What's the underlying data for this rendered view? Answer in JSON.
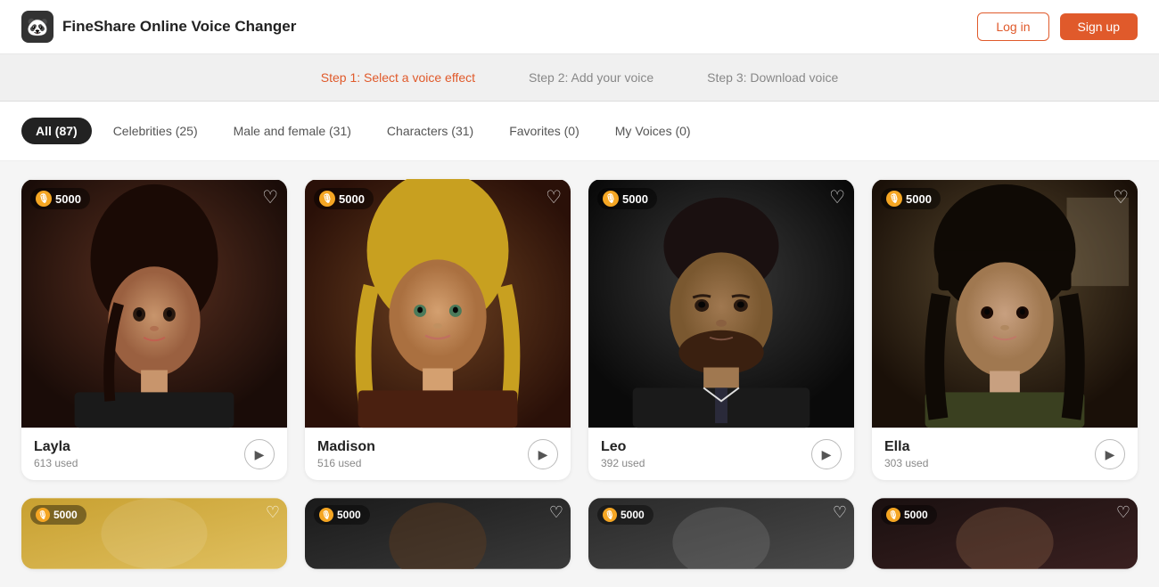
{
  "header": {
    "logo_emoji": "🐼",
    "app_title": "FineShare Online Voice Changer",
    "login_label": "Log in",
    "signup_label": "Sign up"
  },
  "steps": [
    {
      "id": "step1",
      "label": "Step 1: Select a voice effect",
      "active": true
    },
    {
      "id": "step2",
      "label": "Step 2: Add your voice",
      "active": false
    },
    {
      "id": "step3",
      "label": "Step 3: Download voice",
      "active": false
    }
  ],
  "filters": [
    {
      "id": "all",
      "label": "All (87)",
      "active": true
    },
    {
      "id": "celebrities",
      "label": "Celebrities (25)",
      "active": false
    },
    {
      "id": "male-female",
      "label": "Male and female (31)",
      "active": false
    },
    {
      "id": "characters",
      "label": "Characters (31)",
      "active": false
    },
    {
      "id": "favorites",
      "label": "Favorites (0)",
      "active": false
    },
    {
      "id": "my-voices",
      "label": "My Voices (0)",
      "active": false
    }
  ],
  "cards": [
    {
      "id": "layla",
      "name": "Layla",
      "used": "613 used",
      "coins": "5000",
      "bg_from": "#2c1810",
      "bg_to": "#5a3020",
      "skin_color": "#c8956c"
    },
    {
      "id": "madison",
      "name": "Madison",
      "used": "516 used",
      "coins": "5000",
      "bg_from": "#3d2010",
      "bg_to": "#6b4020",
      "skin_color": "#d4a070"
    },
    {
      "id": "leo",
      "name": "Leo",
      "used": "392 used",
      "coins": "5000",
      "bg_from": "#1a1a1a",
      "bg_to": "#3a3a3a",
      "skin_color": "#a07850"
    },
    {
      "id": "ella",
      "name": "Ella",
      "used": "303 used",
      "coins": "5000",
      "bg_from": "#2a2015",
      "bg_to": "#5a4a30",
      "skin_color": "#c8a080"
    }
  ],
  "bottom_cards": [
    {
      "id": "b1",
      "coins": "5000",
      "bg_from": "#c8a030",
      "bg_to": "#e0c060"
    },
    {
      "id": "b2",
      "coins": "5000",
      "bg_from": "#1a1a1a",
      "bg_to": "#3a3a3a"
    },
    {
      "id": "b3",
      "coins": "5000",
      "bg_from": "#2a2a2a",
      "bg_to": "#4a4a4a"
    },
    {
      "id": "b4",
      "coins": "5000",
      "bg_from": "#1a1010",
      "bg_to": "#3a2020"
    }
  ],
  "coin_icon": "🎙",
  "heart_icon": "♡",
  "play_icon": "▶"
}
